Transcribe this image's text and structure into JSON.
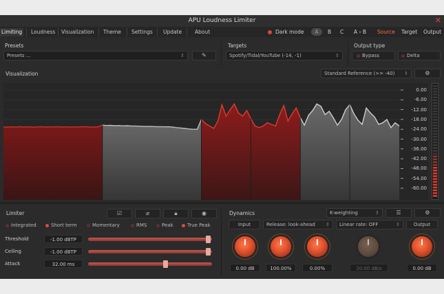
{
  "window": {
    "title": "APU Loudness Limiter"
  },
  "menu": {
    "items": [
      "Limiting",
      "Loudness",
      "Visualization",
      "Theme",
      "Settings",
      "Update",
      "About"
    ],
    "dark_mode_label": "Dark mode",
    "ab": {
      "a": "A",
      "b": "B",
      "c": "C",
      "atob": "A › B"
    },
    "source": "Source",
    "target": "Target",
    "output": "Output"
  },
  "presets": {
    "label": "Presets",
    "value": "Presets ..."
  },
  "targets": {
    "label": "Targets",
    "value": "Spotify/Tidal/YouTube (-14, -1)"
  },
  "output_type": {
    "label": "Output type",
    "bypass": "Bypass",
    "delta": "Delta"
  },
  "visualization": {
    "label": "Visualization",
    "reference": "Standard Reference (>= -40)",
    "y_labels": [
      "0.00",
      "-6.00",
      "-12.00",
      "-18.00",
      "-24.00",
      "-30.00",
      "-36.00",
      "-42.00",
      "-48.00",
      "-54.00",
      "-60.00"
    ]
  },
  "chart_data": {
    "type": "area",
    "ylim": [
      -60,
      0
    ],
    "x": [
      0,
      1,
      2,
      3,
      4,
      5,
      6,
      7,
      8,
      9,
      10,
      11,
      12,
      13,
      14,
      15,
      16,
      17,
      18,
      19,
      20,
      21,
      22,
      23,
      24,
      25,
      26,
      27,
      28,
      29,
      30,
      31,
      32,
      33,
      34,
      35,
      36,
      37,
      38,
      39,
      40,
      41,
      42,
      43,
      44,
      45,
      46,
      47,
      48,
      49,
      50,
      51,
      52,
      53,
      54,
      55,
      56,
      57,
      58,
      59,
      60,
      61,
      62,
      63,
      64,
      65,
      66,
      67,
      68,
      69,
      70,
      71,
      72,
      73,
      74,
      75,
      76,
      77,
      78,
      79,
      80,
      81,
      82,
      83,
      84,
      85,
      86,
      87,
      88,
      89,
      90,
      91,
      92,
      93,
      94,
      95,
      96
    ],
    "series": [
      {
        "values": [
          -22.6,
          -22.6,
          -22.5,
          -22.7,
          -22.4,
          -22.6,
          -22.5,
          -22.7,
          -22.6,
          -22.4,
          -22.6,
          -22.5,
          -22.6,
          -22.4,
          -22.6,
          -22.5,
          -22.7,
          -22.5,
          -22.6,
          -22.5,
          -22.4,
          -22.6,
          -22.7,
          -22.5,
          -21.5,
          -21.7,
          -21.6,
          -21.8,
          -21.7,
          -21.9,
          -21.8,
          -22.0,
          -22.0,
          -22.1,
          -22.2,
          -22.3,
          -22.3,
          -22.4,
          -22.4,
          -22.5,
          -22.4,
          -22.6,
          -23.0,
          -23.2,
          -23.5,
          -23.8,
          -24.0,
          -24.0,
          -18.0,
          -20.5,
          -22.0,
          -23.5,
          -19.0,
          -9.0,
          -16.0,
          -12.0,
          -8.5,
          -14.0,
          -16.0,
          -12.5,
          -17.5,
          -22.0,
          -23.0,
          -22.0,
          -20.0,
          -21.0,
          -22.0,
          -15.0,
          -9.5,
          -19.0,
          -14.5,
          -11.0,
          -17.0,
          -21.5,
          -15.5,
          -12.5,
          -8.5,
          -10.0,
          -15.0,
          -13.0,
          -17.0,
          -21.5,
          -18.0,
          -12.0,
          -9.0,
          -14.5,
          -18.5,
          -21.0,
          -11.0,
          -14.0,
          -16.5,
          -21.0,
          -20.0,
          -18.0,
          -23.0,
          -20.0,
          -22.0
        ]
      }
    ]
  },
  "limiter": {
    "label": "Limiter",
    "modes": [
      "Integrated",
      "Short term",
      "Momentary",
      "RMS",
      "Peak",
      "True Peak"
    ],
    "active_modes": [
      false,
      true,
      false,
      false,
      false,
      true
    ],
    "threshold": {
      "label": "Threshold",
      "value": "-1.00 dBTP",
      "level": 0.97
    },
    "ceiling": {
      "label": "Ceiling",
      "value": "-1.00 dBTP",
      "level": 0.97
    },
    "attack": {
      "label": "Attack",
      "value": "32.00 ms",
      "level": 0.63
    }
  },
  "dynamics": {
    "label": "Dynamics",
    "weighting": "K-weighting",
    "input": "Input",
    "release": "Release: look-ahead",
    "linear_rate": "Linear rate: OFF",
    "output": "Output",
    "knobs": [
      "0.00 dB",
      "100.00%",
      "0.00%",
      "20.00 dB/s",
      "0.00 dB"
    ]
  },
  "colors": {
    "accent": "#e0402e",
    "section_red": "#8a1c1c",
    "section_gray": "#6a6a6a"
  }
}
